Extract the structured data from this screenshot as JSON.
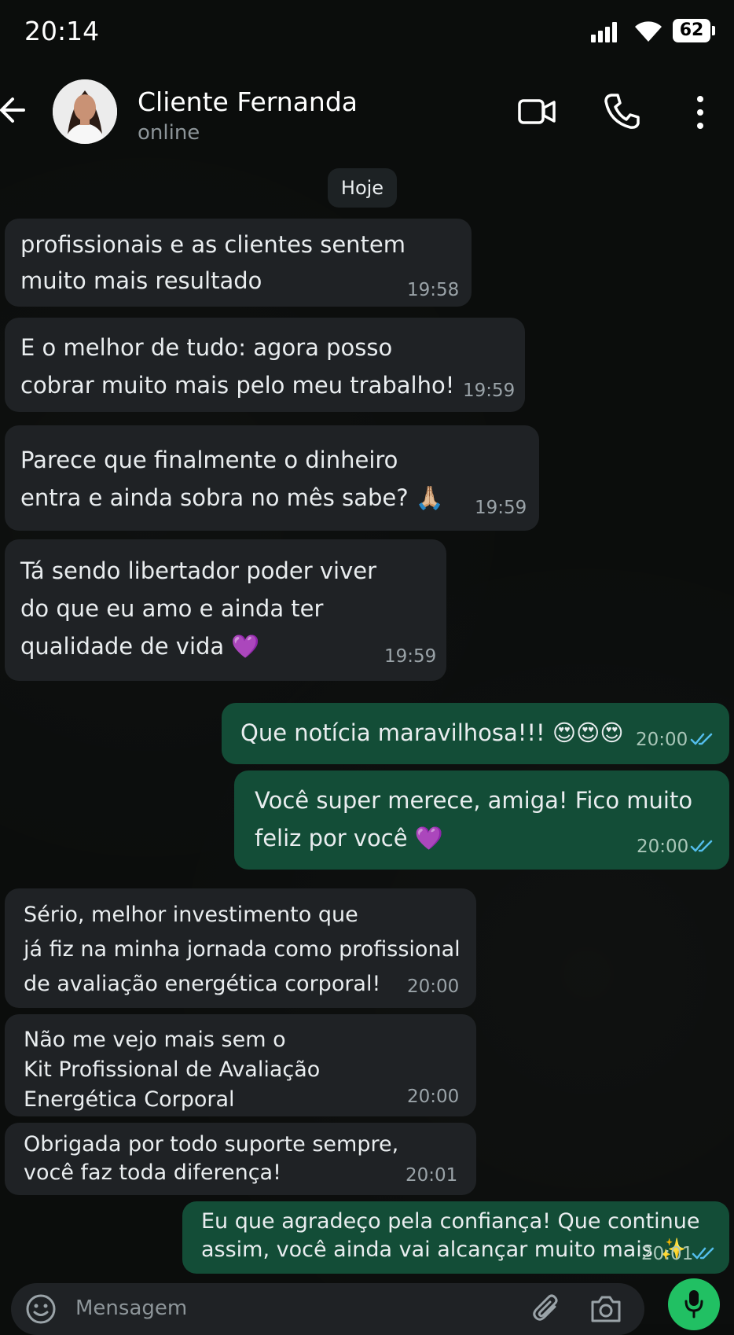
{
  "status_bar": {
    "time": "20:14",
    "battery": "62"
  },
  "header": {
    "contact_name": "Cliente Fernanda",
    "status": "online"
  },
  "date_chip": "Hoje",
  "messages": [
    {
      "dir": "in",
      "text": "profissionais e as clientes sentem\nmuito mais resultado",
      "time": "19:58"
    },
    {
      "dir": "in",
      "text": "E o melhor de tudo: agora posso\ncobrar muito mais pelo meu trabalho!",
      "time": "19:59"
    },
    {
      "dir": "in",
      "text": "Parece que finalmente o dinheiro\nentra e ainda sobra no mês sabe? 🙏🏼",
      "time": "19:59"
    },
    {
      "dir": "in",
      "text": "Tá sendo libertador poder viver\ndo que eu amo e ainda ter\nqualidade de vida 💜",
      "time": "19:59"
    },
    {
      "dir": "out",
      "text": "Que notícia maravilhosa!!! 😍😍😍",
      "time": "20:00"
    },
    {
      "dir": "out",
      "text": "Você super merece, amiga! Fico muito\nfeliz por você 💜",
      "time": "20:00"
    },
    {
      "dir": "in",
      "text": "Sério, melhor investimento que\njá fiz na minha jornada como profissional\nde avaliação energética corporal!",
      "time": "20:00"
    },
    {
      "dir": "in",
      "text": "Não me vejo mais sem o\nKit Profissional de Avaliação\nEnergética Corporal",
      "time": "20:00"
    },
    {
      "dir": "in",
      "text": "Obrigada por todo suporte sempre,\nvocê faz toda diferença!",
      "time": "20:01"
    },
    {
      "dir": "out",
      "text": "Eu que agradeço pela confiança! Que continue\nassim, você ainda vai alcançar muito mais ✨",
      "time": "20:01"
    }
  ],
  "footer": {
    "placeholder": "Mensagem"
  },
  "colors": {
    "incoming_bubble": "#1f2225",
    "outgoing_bubble": "#134d37",
    "accent": "#21c063",
    "read_ticks": "#53bdeb"
  }
}
